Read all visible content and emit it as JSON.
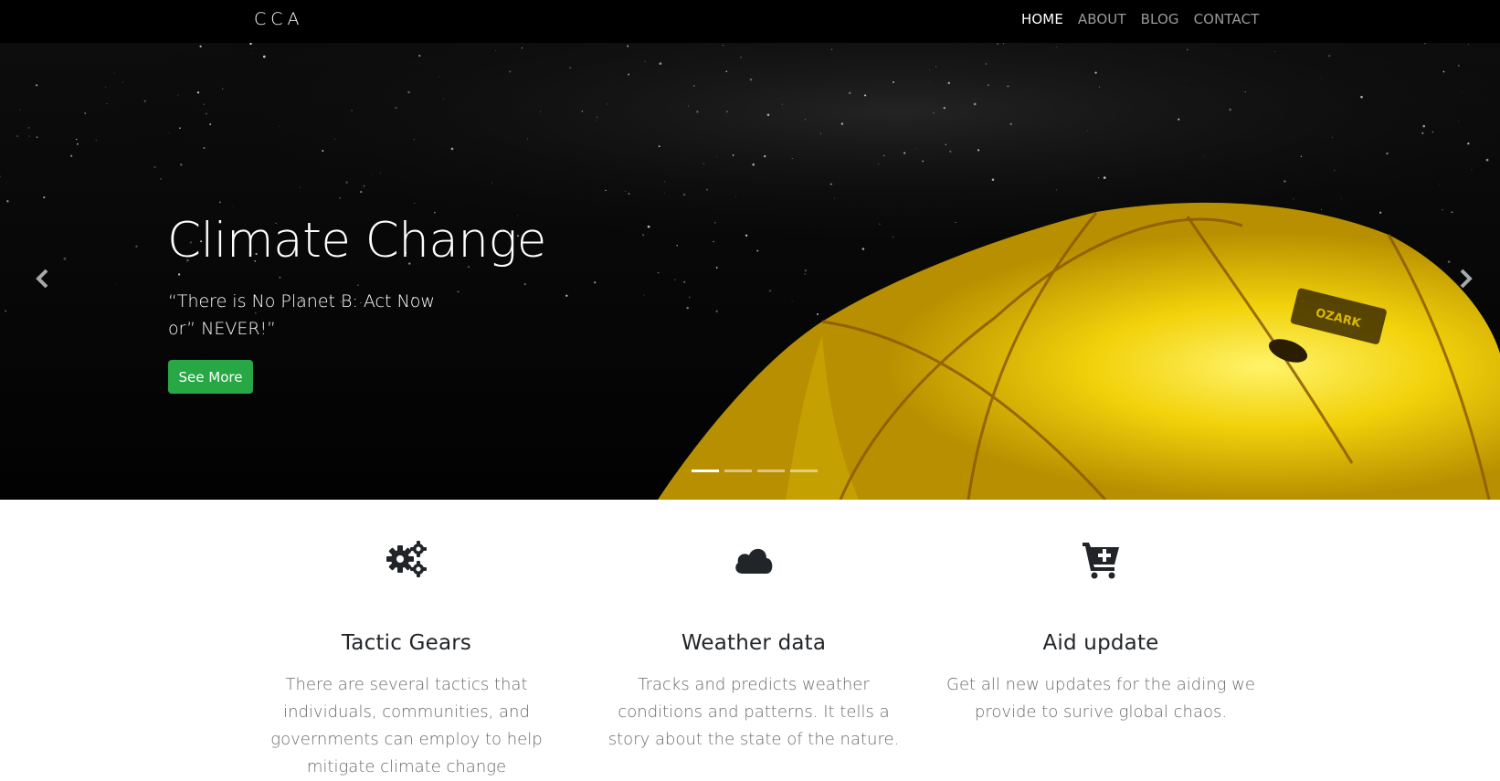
{
  "navbar": {
    "brand": "CCA",
    "links": [
      {
        "label": "HOME",
        "active": true
      },
      {
        "label": "ABOUT",
        "active": false
      },
      {
        "label": "BLOG",
        "active": false
      },
      {
        "label": "CONTACT",
        "active": false
      }
    ]
  },
  "hero": {
    "title": "Climate Change",
    "quote": "“There is No Planet B: Act Now or” NEVER!”",
    "button_label": "See More",
    "prev_icon": "chevron-left-icon",
    "next_icon": "chevron-right-icon",
    "tent_label": "OZARK",
    "slide_count": 4,
    "active_slide": 1
  },
  "features": [
    {
      "icon": "gears-icon",
      "title": "Tactic Gears",
      "description": "There are several tactics that individuals, communities, and governments can employ to help mitigate climate change"
    },
    {
      "icon": "cloud-icon",
      "title": "Weather data",
      "description": "Tracks and predicts weather conditions and patterns. It tells a story about the state of the nature."
    },
    {
      "icon": "cart-plus-icon",
      "title": "Aid update",
      "description": "Get all new updates for the aiding we provide to surive global chaos."
    }
  ],
  "colors": {
    "navbar_bg": "#000000",
    "accent_green": "#28a745",
    "tent_yellow": "#f2d20b",
    "text_dark": "#212529",
    "text_muted": "#6a6a6a"
  }
}
